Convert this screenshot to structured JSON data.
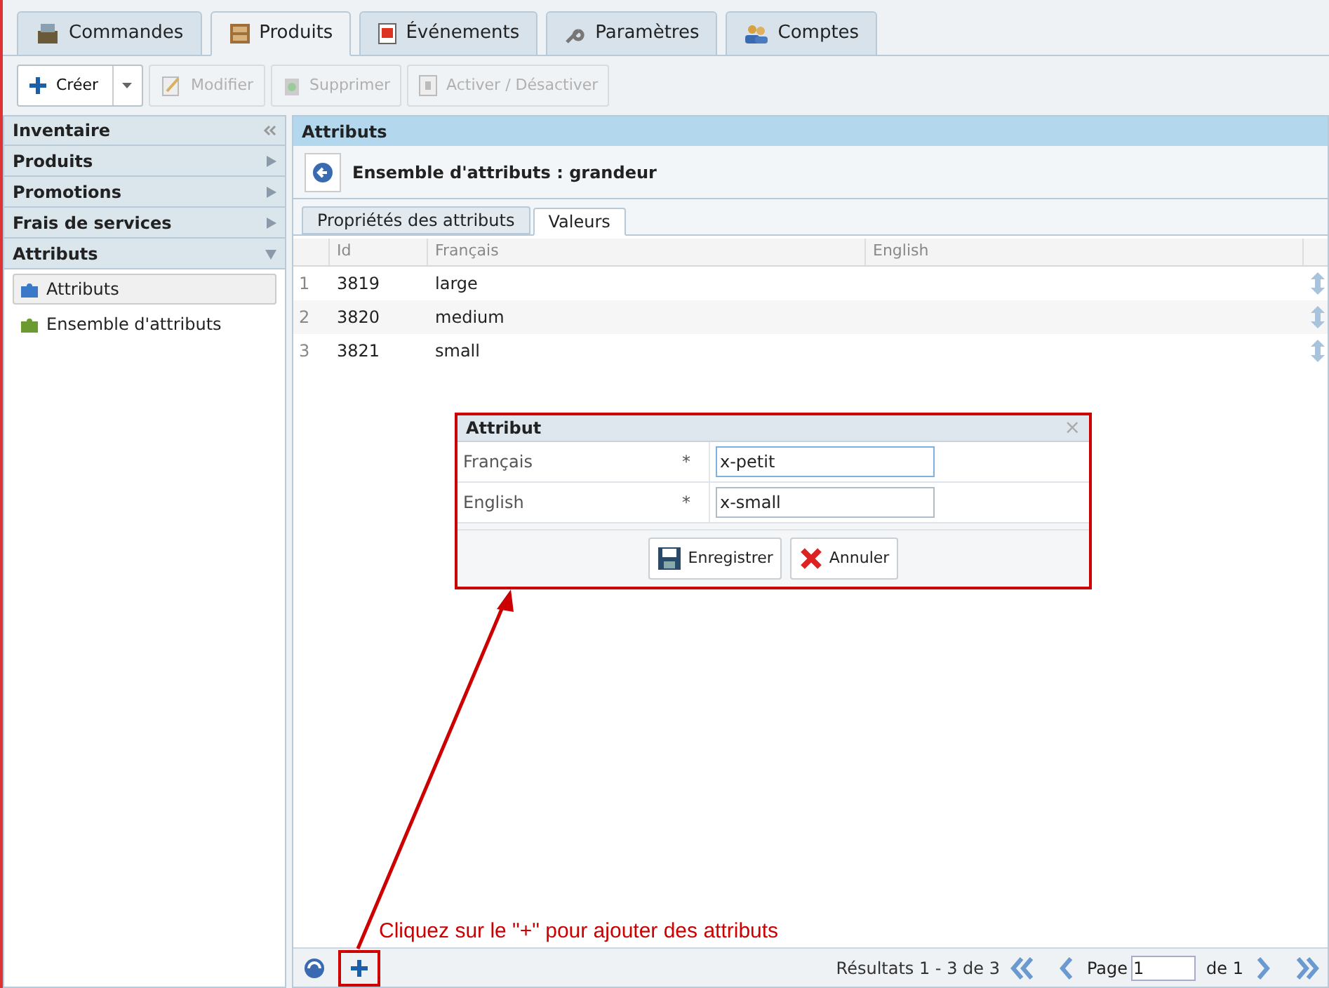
{
  "tabs": [
    {
      "label": "Commandes",
      "kind": "register",
      "selected": false
    },
    {
      "label": "Produits",
      "kind": "cabinet",
      "selected": true
    },
    {
      "label": "Événements",
      "kind": "calendar",
      "selected": false
    },
    {
      "label": "Paramètres",
      "kind": "wrench",
      "selected": false
    },
    {
      "label": "Comptes",
      "kind": "users",
      "selected": false
    }
  ],
  "toolbar": [
    {
      "label": "Créer",
      "kind": "create",
      "disabled": false
    },
    {
      "label": "Modifier",
      "kind": "edit",
      "disabled": true
    },
    {
      "label": "Supprimer",
      "kind": "delete",
      "disabled": true
    },
    {
      "label": "Activer / Désactiver",
      "kind": "toggle",
      "disabled": true
    }
  ],
  "sidebar": {
    "title": "Inventaire",
    "sections": [
      {
        "label": "Produits",
        "expanded": false
      },
      {
        "label": "Promotions",
        "expanded": false
      },
      {
        "label": "Frais de services",
        "expanded": false
      },
      {
        "label": "Attributs",
        "expanded": true,
        "children": [
          {
            "label": "Attributs",
            "selected": true
          },
          {
            "label": "Ensemble d'attributs",
            "selected": false
          }
        ]
      }
    ]
  },
  "panel": {
    "title": "Attributs",
    "heading": "Ensemble d'attributs : grandeur",
    "subtabs": [
      {
        "label": "Propriétés des attributs",
        "selected": false
      },
      {
        "label": "Valeurs",
        "selected": true
      }
    ],
    "table": {
      "columns": [
        "Id",
        "Français",
        "English"
      ],
      "rows": [
        {
          "num": "1",
          "id": "3819",
          "fr": "large"
        },
        {
          "num": "2",
          "id": "3820",
          "fr": "medium"
        },
        {
          "num": "3",
          "id": "3821",
          "fr": "small"
        }
      ]
    },
    "pager": {
      "results": "Résultats 1 - 3 de 3",
      "page_label": "Page",
      "page": "1",
      "of": "de 1"
    }
  },
  "dialog": {
    "title": "Attribut",
    "close": "×",
    "fields": [
      {
        "label": "Français",
        "required": "*",
        "value": "x-petit",
        "focused": true
      },
      {
        "label": "English",
        "required": "*",
        "value": "x-small",
        "focused": false
      }
    ],
    "buttons": [
      {
        "label": "Enregistrer",
        "kind": "save"
      },
      {
        "label": "Annuler",
        "kind": "cancel"
      }
    ]
  },
  "annotation": "Cliquez sur le \"+\" pour ajouter des attributs"
}
